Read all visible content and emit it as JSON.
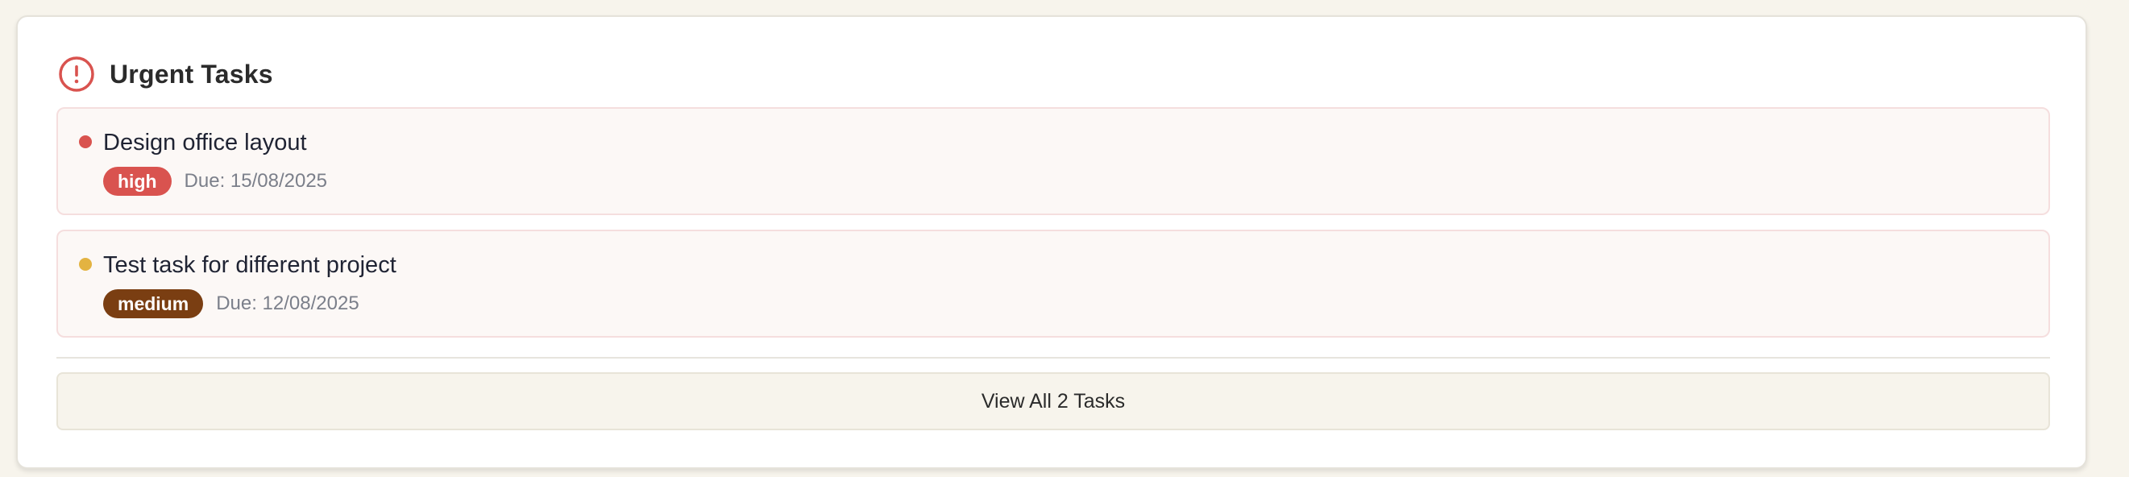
{
  "widget": {
    "title": "Urgent Tasks",
    "icon": "alert-circle-icon",
    "accent_color": "#d9534f"
  },
  "tasks": [
    {
      "title": "Design office layout",
      "priority": "high",
      "priority_color": "#d9534f",
      "dot_color": "#d9534f",
      "due": "Due: 15/08/2025"
    },
    {
      "title": "Test task for different project",
      "priority": "medium",
      "priority_color": "#7a3e12",
      "dot_color": "#e3b341",
      "due": "Due: 12/08/2025"
    }
  ],
  "footer": {
    "view_all_label": "View All 2 Tasks"
  }
}
